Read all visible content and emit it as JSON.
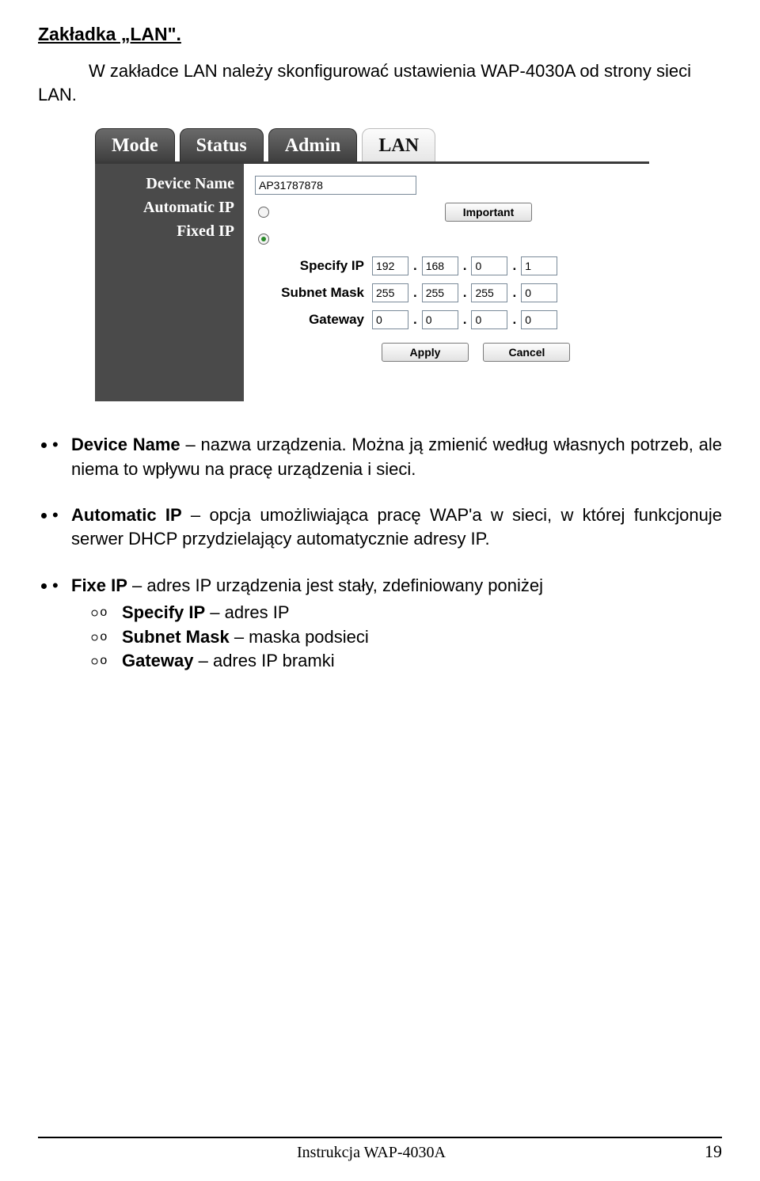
{
  "heading": "Zakładka „LAN\".",
  "intro": "W zakładce LAN należy skonfigurować ustawienia WAP-4030A od strony sieci LAN.",
  "screenshot": {
    "tabs": [
      {
        "label": "Mode",
        "active": false
      },
      {
        "label": "Status",
        "active": false
      },
      {
        "label": "Admin",
        "active": false
      },
      {
        "label": "LAN",
        "active": true
      }
    ],
    "sidebar": [
      "Device Name",
      "Automatic IP",
      "Fixed IP"
    ],
    "device_name_value": "AP31787878",
    "automatic_ip_checked": false,
    "fixed_ip_checked": true,
    "buttons": {
      "important": "Important",
      "apply": "Apply",
      "cancel": "Cancel"
    },
    "labels": {
      "specify_ip": "Specify IP",
      "subnet_mask": "Subnet Mask",
      "gateway": "Gateway"
    },
    "ip": [
      "192",
      "168",
      "0",
      "1"
    ],
    "mask": [
      "255",
      "255",
      "255",
      "0"
    ],
    "gw": [
      "0",
      "0",
      "0",
      "0"
    ]
  },
  "list": [
    {
      "bold": "Device Name",
      "rest": " – nazwa urządzenia. Można ją zmienić według własnych potrzeb, ale niema to wpływu na pracę urządzenia i sieci."
    },
    {
      "bold": "Automatic IP",
      "rest": " – opcja umożliwiająca pracę WAP'a w sieci, w której funkcjonuje serwer DHCP przydzielający automatycznie adresy IP."
    },
    {
      "bold": "Fixe IP",
      "rest": " – adres IP urządzenia jest stały, zdefiniowany poniżej",
      "sub": [
        {
          "bold": "Specify IP",
          "rest": " – adres IP"
        },
        {
          "bold": "Subnet Mask",
          "rest": " – maska podsieci"
        },
        {
          "bold": "Gateway",
          "rest": " – adres IP bramki"
        }
      ]
    }
  ],
  "footer": {
    "label": "Instrukcja WAP-4030A",
    "page": "19"
  }
}
